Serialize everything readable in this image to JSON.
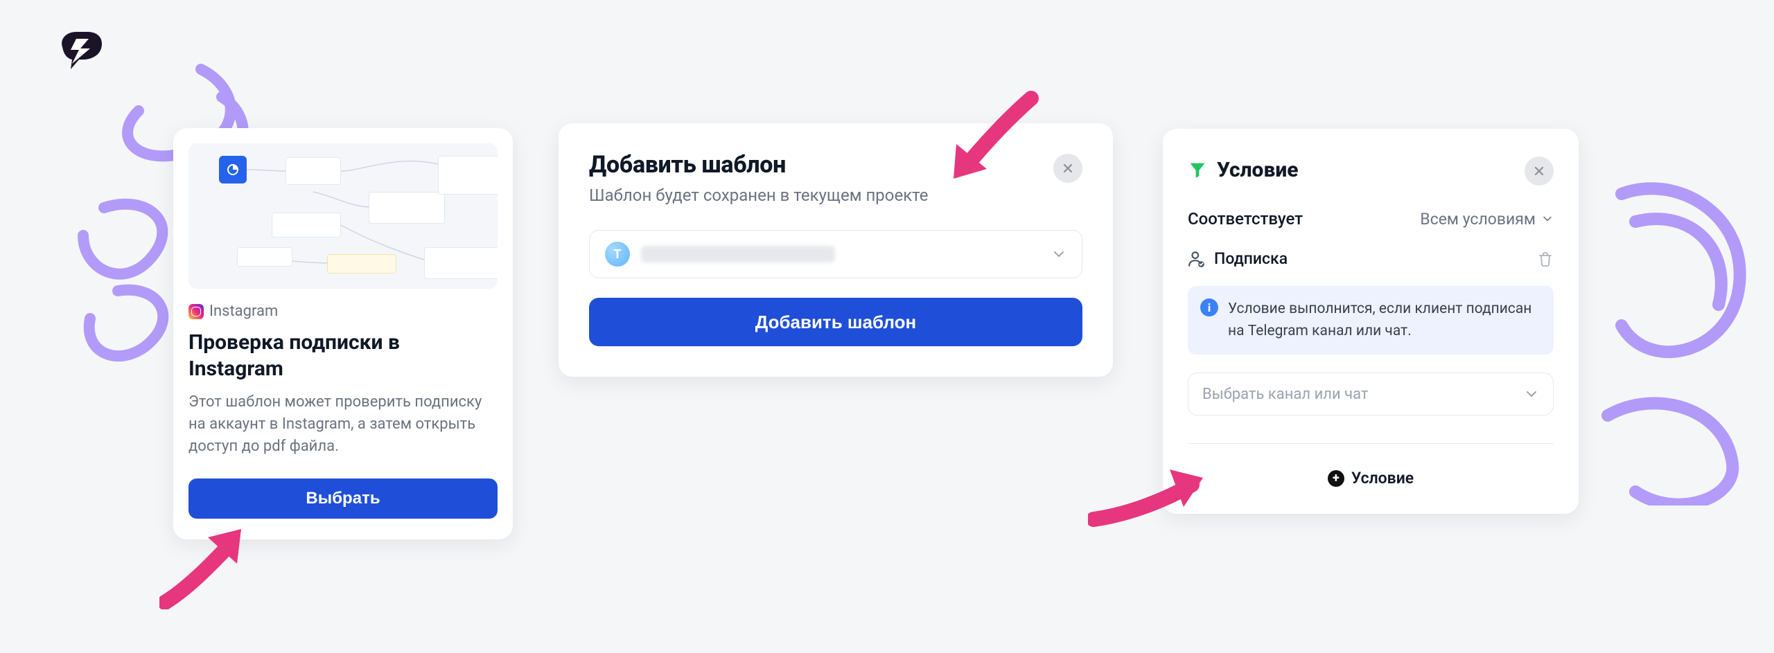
{
  "template_card": {
    "tag": "Instagram",
    "title": "Проверка подписки в Instagram",
    "description": "Этот шаблон может проверить подписку на аккаунт в Instagram, а затем открыть доступ до pdf файла.",
    "select_button": "Выбрать"
  },
  "modal": {
    "title": "Добавить шаблон",
    "subtitle": "Шаблон будет сохранен в текущем проекте",
    "chip_letter": "T",
    "submit_button": "Добавить шаблон"
  },
  "condition": {
    "title": "Условие",
    "match_label": "Соответствует",
    "match_value": "Всем условиям",
    "sub_label": "Подписка",
    "info_text": "Условие выполнится, если клиент подписан на Telegram канал или чат.",
    "select_placeholder": "Выбрать канал или чат",
    "add_button": "Условие"
  }
}
